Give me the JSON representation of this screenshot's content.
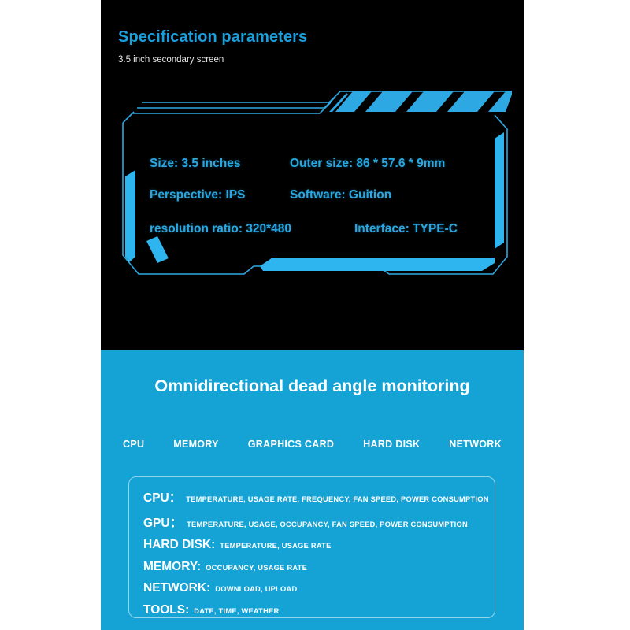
{
  "header": {
    "title": "Specification parameters",
    "subtitle": "3.5 inch secondary screen"
  },
  "specs": {
    "size": "Size: 3.5 inches",
    "outer_size": "Outer size: 86 * 57.6 * 9mm",
    "perspective": "Perspective: IPS",
    "software": "Software:  Guition",
    "resolution": "resolution ratio:  320*480",
    "interface": "Interface: TYPE-C"
  },
  "monitoring": {
    "title": "Omnidirectional dead angle monitoring",
    "categories": [
      "CPU",
      "MEMORY",
      "GRAPHICS CARD",
      "HARD DISK",
      "NETWORK"
    ],
    "items": [
      {
        "key": "CPU：",
        "value": "TEMPERATURE, USAGE RATE, FREQUENCY, FAN SPEED, POWER CONSUMPTION"
      },
      {
        "key": "GPU：",
        "value": "TEMPERATURE, USAGE, OCCUPANCY, FAN SPEED, POWER CONSUMPTION"
      },
      {
        "key": "HARD DISK:",
        "value": "TEMPERATURE, USAGE RATE"
      },
      {
        "key": "MEMORY:",
        "value": "OCCUPANCY, USAGE RATE"
      },
      {
        "key": "NETWORK:",
        "value": "DOWNLOAD, UPLOAD"
      },
      {
        "key": "TOOLS:",
        "value": "DATE, TIME, WEATHER"
      }
    ]
  },
  "colors": {
    "accent_blue": "#29a7e0",
    "title_blue": "#1a9fdb",
    "panel_blue": "#14a3d4",
    "dark": "#000000",
    "white": "#ffffff"
  }
}
